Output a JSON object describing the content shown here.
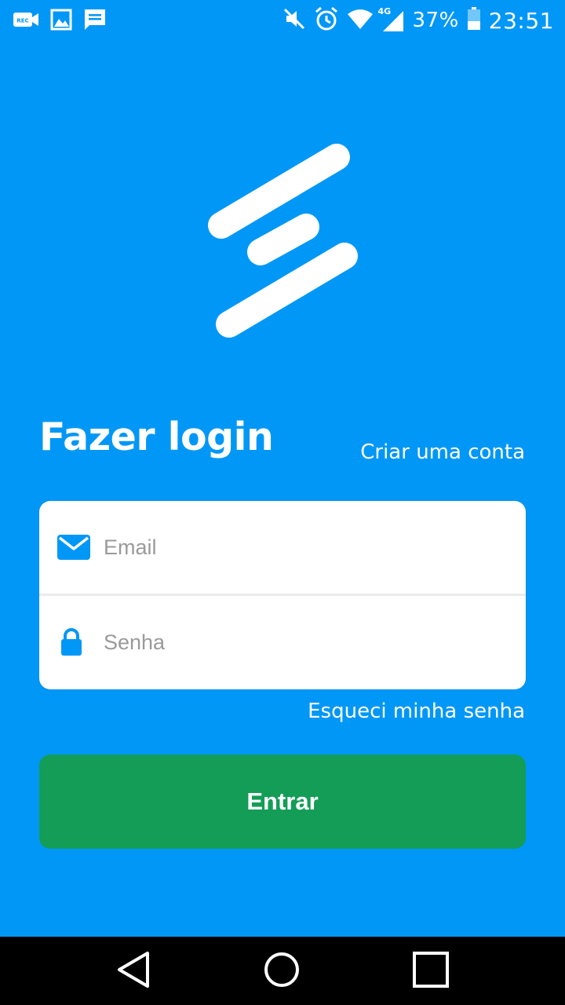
{
  "status_bar": {
    "left_icons": [
      "screen-recorder-icon",
      "gallery-icon",
      "message-icon"
    ],
    "right_icons": [
      "mute-icon",
      "alarm-icon",
      "wifi-icon",
      "signal-4g-icon",
      "battery-icon"
    ],
    "network_label": "4G",
    "battery_percent": "37%",
    "time": "23:51"
  },
  "login": {
    "title": "Fazer login",
    "create_account_link": "Criar uma conta",
    "email_placeholder": "Email",
    "password_placeholder": "Senha",
    "forgot_password_link": "Esqueci minha senha",
    "submit_label": "Entrar"
  },
  "colors": {
    "background": "#0197f6",
    "button": "#139d56",
    "icon": "#0197f6"
  },
  "nav_bar": {
    "buttons": [
      "back-icon",
      "home-icon",
      "recents-icon"
    ]
  }
}
